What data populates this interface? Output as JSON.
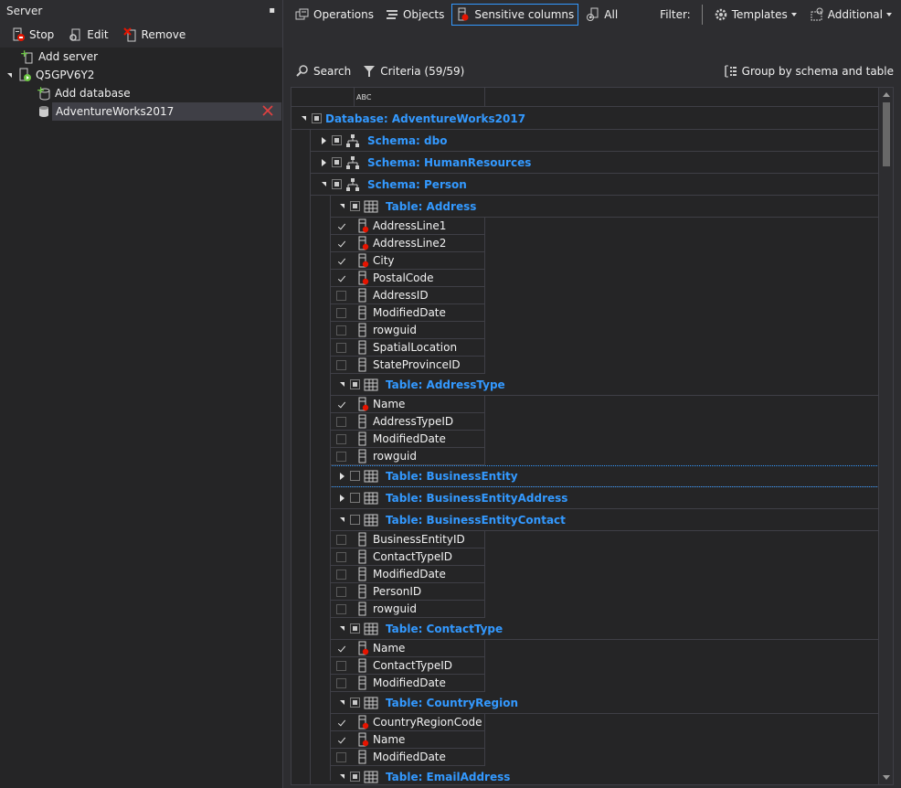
{
  "left": {
    "header": "Server",
    "pin_glyph": "▪",
    "toolbar": {
      "stop": "Stop",
      "edit": "Edit",
      "remove": "Remove"
    },
    "tree": {
      "add_server": "Add server",
      "server_name": "Q5GPV6Y2",
      "add_database": "Add database",
      "database_name": "AdventureWorks2017"
    }
  },
  "top": {
    "operations": "Operations",
    "objects": "Objects",
    "sensitive_columns": "Sensitive columns",
    "all": "All",
    "filter": "Filter:",
    "templates": "Templates",
    "additional": "Additional"
  },
  "search": {
    "search": "Search",
    "criteria": "Criteria (59/59)",
    "group_by": "Group by schema and table"
  },
  "grid": {
    "col_header_icon": "ABC",
    "rows": [
      {
        "type": "database",
        "label": "Database: AdventureWorks2017",
        "expanded": true,
        "state": "ind"
      },
      {
        "type": "schema",
        "label": "Schema: dbo",
        "expanded": false,
        "state": "ind"
      },
      {
        "type": "schema",
        "label": "Schema: HumanResources",
        "expanded": false,
        "state": "ind"
      },
      {
        "type": "schema",
        "label": "Schema: Person",
        "expanded": true,
        "state": "ind"
      },
      {
        "type": "table",
        "label": "Table: Address",
        "expanded": true,
        "state": "ind"
      },
      {
        "type": "col",
        "label": "AddressLine1",
        "checked": true,
        "sensitive": true
      },
      {
        "type": "col",
        "label": "AddressLine2",
        "checked": true,
        "sensitive": true
      },
      {
        "type": "col",
        "label": "City",
        "checked": true,
        "sensitive": true
      },
      {
        "type": "col",
        "label": "PostalCode",
        "checked": true,
        "sensitive": true
      },
      {
        "type": "col",
        "label": "AddressID",
        "checked": false,
        "sensitive": false
      },
      {
        "type": "col",
        "label": "ModifiedDate",
        "checked": false,
        "sensitive": false
      },
      {
        "type": "col",
        "label": "rowguid",
        "checked": false,
        "sensitive": false
      },
      {
        "type": "col",
        "label": "SpatialLocation",
        "checked": false,
        "sensitive": false
      },
      {
        "type": "col",
        "label": "StateProvinceID",
        "checked": false,
        "sensitive": false
      },
      {
        "type": "table",
        "label": "Table: AddressType",
        "expanded": true,
        "state": "ind"
      },
      {
        "type": "col",
        "label": "Name",
        "checked": true,
        "sensitive": true
      },
      {
        "type": "col",
        "label": "AddressTypeID",
        "checked": false,
        "sensitive": false
      },
      {
        "type": "col",
        "label": "ModifiedDate",
        "checked": false,
        "sensitive": false
      },
      {
        "type": "col",
        "label": "rowguid",
        "checked": false,
        "sensitive": false
      },
      {
        "type": "table",
        "label": "Table: BusinessEntity",
        "expanded": false,
        "state": "none",
        "focused": true
      },
      {
        "type": "table",
        "label": "Table: BusinessEntityAddress",
        "expanded": false,
        "state": "none"
      },
      {
        "type": "table",
        "label": "Table: BusinessEntityContact",
        "expanded": true,
        "state": "none"
      },
      {
        "type": "col",
        "label": "BusinessEntityID",
        "checked": false,
        "sensitive": false
      },
      {
        "type": "col",
        "label": "ContactTypeID",
        "checked": false,
        "sensitive": false
      },
      {
        "type": "col",
        "label": "ModifiedDate",
        "checked": false,
        "sensitive": false
      },
      {
        "type": "col",
        "label": "PersonID",
        "checked": false,
        "sensitive": false
      },
      {
        "type": "col",
        "label": "rowguid",
        "checked": false,
        "sensitive": false
      },
      {
        "type": "table",
        "label": "Table: ContactType",
        "expanded": true,
        "state": "ind"
      },
      {
        "type": "col",
        "label": "Name",
        "checked": true,
        "sensitive": true
      },
      {
        "type": "col",
        "label": "ContactTypeID",
        "checked": false,
        "sensitive": false
      },
      {
        "type": "col",
        "label": "ModifiedDate",
        "checked": false,
        "sensitive": false
      },
      {
        "type": "table",
        "label": "Table: CountryRegion",
        "expanded": true,
        "state": "ind"
      },
      {
        "type": "col",
        "label": "CountryRegionCode",
        "checked": true,
        "sensitive": true
      },
      {
        "type": "col",
        "label": "Name",
        "checked": true,
        "sensitive": true
      },
      {
        "type": "col",
        "label": "ModifiedDate",
        "checked": false,
        "sensitive": false
      },
      {
        "type": "table",
        "label": "Table: EmailAddress",
        "expanded": true,
        "state": "ind"
      }
    ]
  },
  "colors": {
    "accent": "#3399ff",
    "sensitive": "#e51400",
    "add": "#6cc644"
  }
}
